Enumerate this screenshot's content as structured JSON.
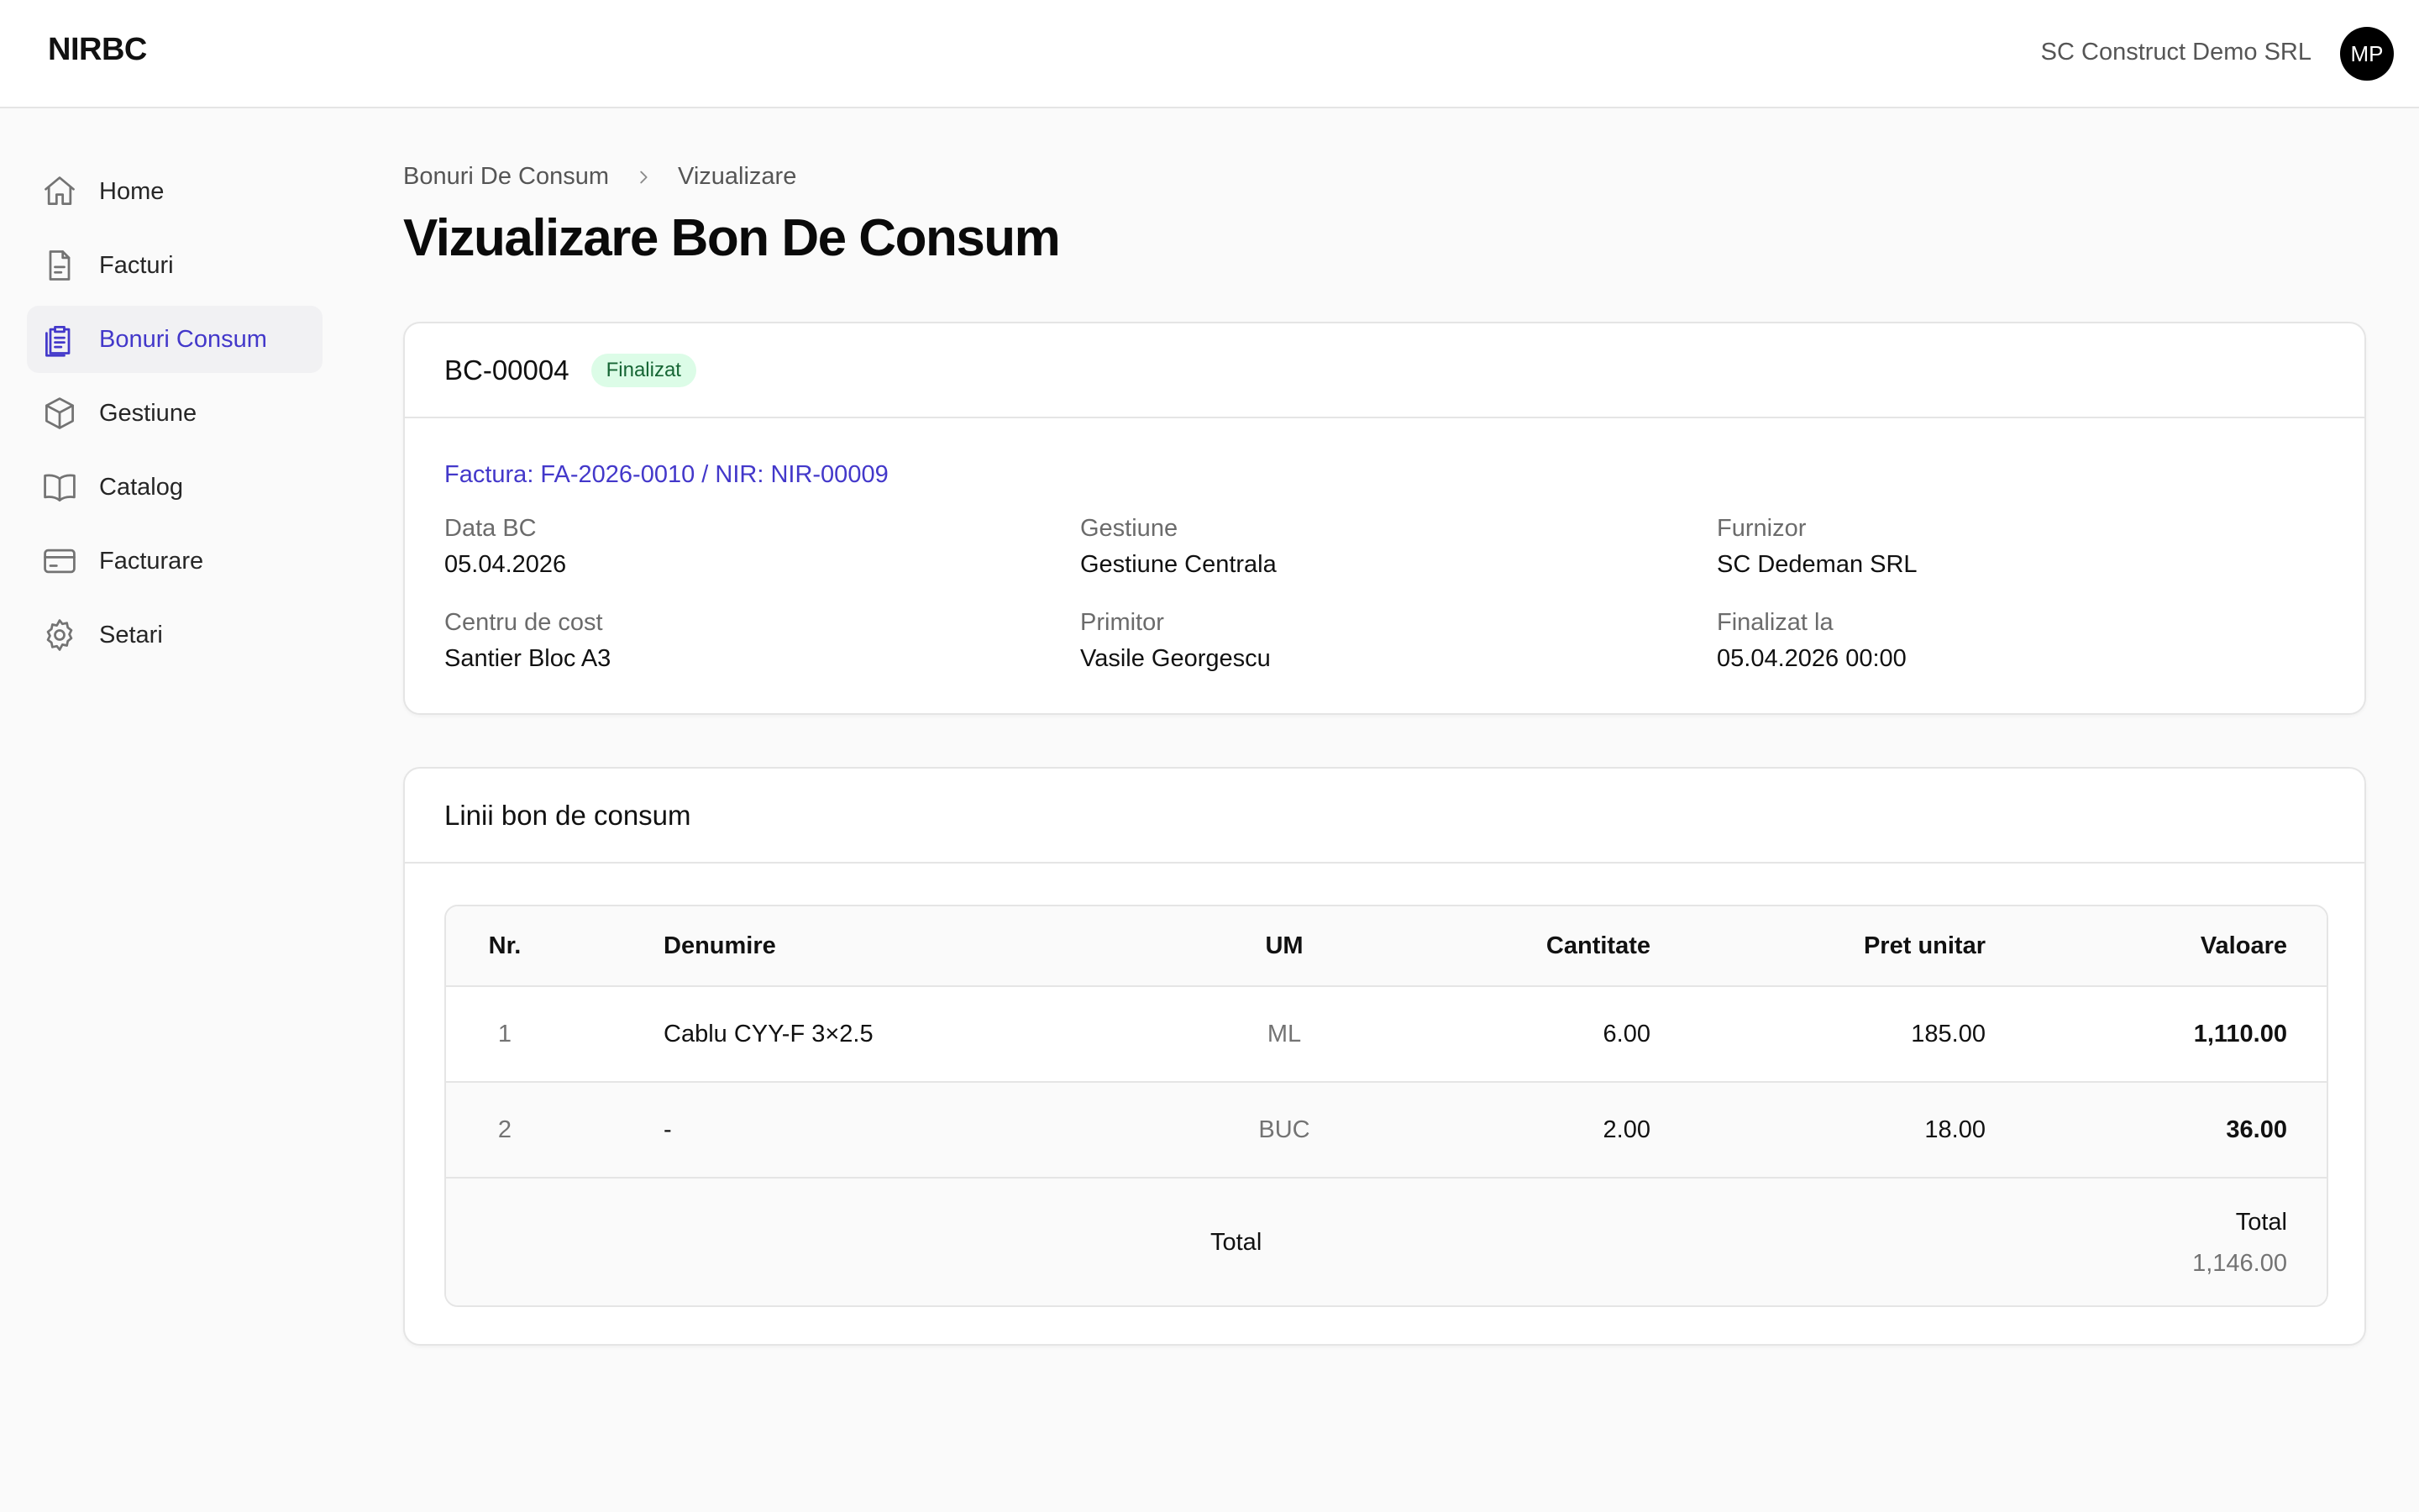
{
  "header": {
    "brand": "NIRBC",
    "company": "SC Construct Demo SRL",
    "avatar_initials": "MP"
  },
  "sidebar": {
    "items": [
      {
        "label": "Home",
        "icon": "home-icon"
      },
      {
        "label": "Facturi",
        "icon": "file-icon"
      },
      {
        "label": "Bonuri Consum",
        "icon": "clipboard-list-icon",
        "active": true
      },
      {
        "label": "Gestiune",
        "icon": "box-icon"
      },
      {
        "label": "Catalog",
        "icon": "book-icon"
      },
      {
        "label": "Facturare",
        "icon": "credit-card-icon"
      },
      {
        "label": "Setari",
        "icon": "gear-icon"
      }
    ],
    "active_color": "#4338ca"
  },
  "breadcrumb": {
    "items": [
      "Bonuri De Consum",
      "Vizualizare"
    ]
  },
  "page": {
    "title": "Vizualizare Bon De Consum"
  },
  "doc": {
    "number": "BC-00004",
    "status": "Finalizat",
    "status_color": "#dcfce7",
    "link": "Factura: FA-2026-0010 / NIR: NIR-00009",
    "fields": [
      {
        "label": "Data BC",
        "value": "05.04.2026"
      },
      {
        "label": "Gestiune",
        "value": "Gestiune Centrala"
      },
      {
        "label": "Furnizor",
        "value": "SC Dedeman SRL"
      },
      {
        "label": "Centru de cost",
        "value": "Santier Bloc A3"
      },
      {
        "label": "Primitor",
        "value": "Vasile Georgescu"
      },
      {
        "label": "Finalizat la",
        "value": "05.04.2026 00:00"
      }
    ]
  },
  "lines": {
    "title": "Linii bon de consum",
    "columns": [
      "Nr.",
      "Denumire",
      "UM",
      "Cantitate",
      "Pret unitar",
      "Valoare"
    ],
    "rows": [
      {
        "nr": "1",
        "den": "Cablu CYY-F 3×2.5",
        "um": "ML",
        "cant": "6.00",
        "pret": "185.00",
        "val": "1,110.00"
      },
      {
        "nr": "2",
        "den": "-",
        "um": "BUC",
        "cant": "2.00",
        "pret": "18.00",
        "val": "36.00"
      }
    ],
    "footer": {
      "label": "Total",
      "right_label": "Total",
      "right_value": "1,146.00"
    }
  }
}
